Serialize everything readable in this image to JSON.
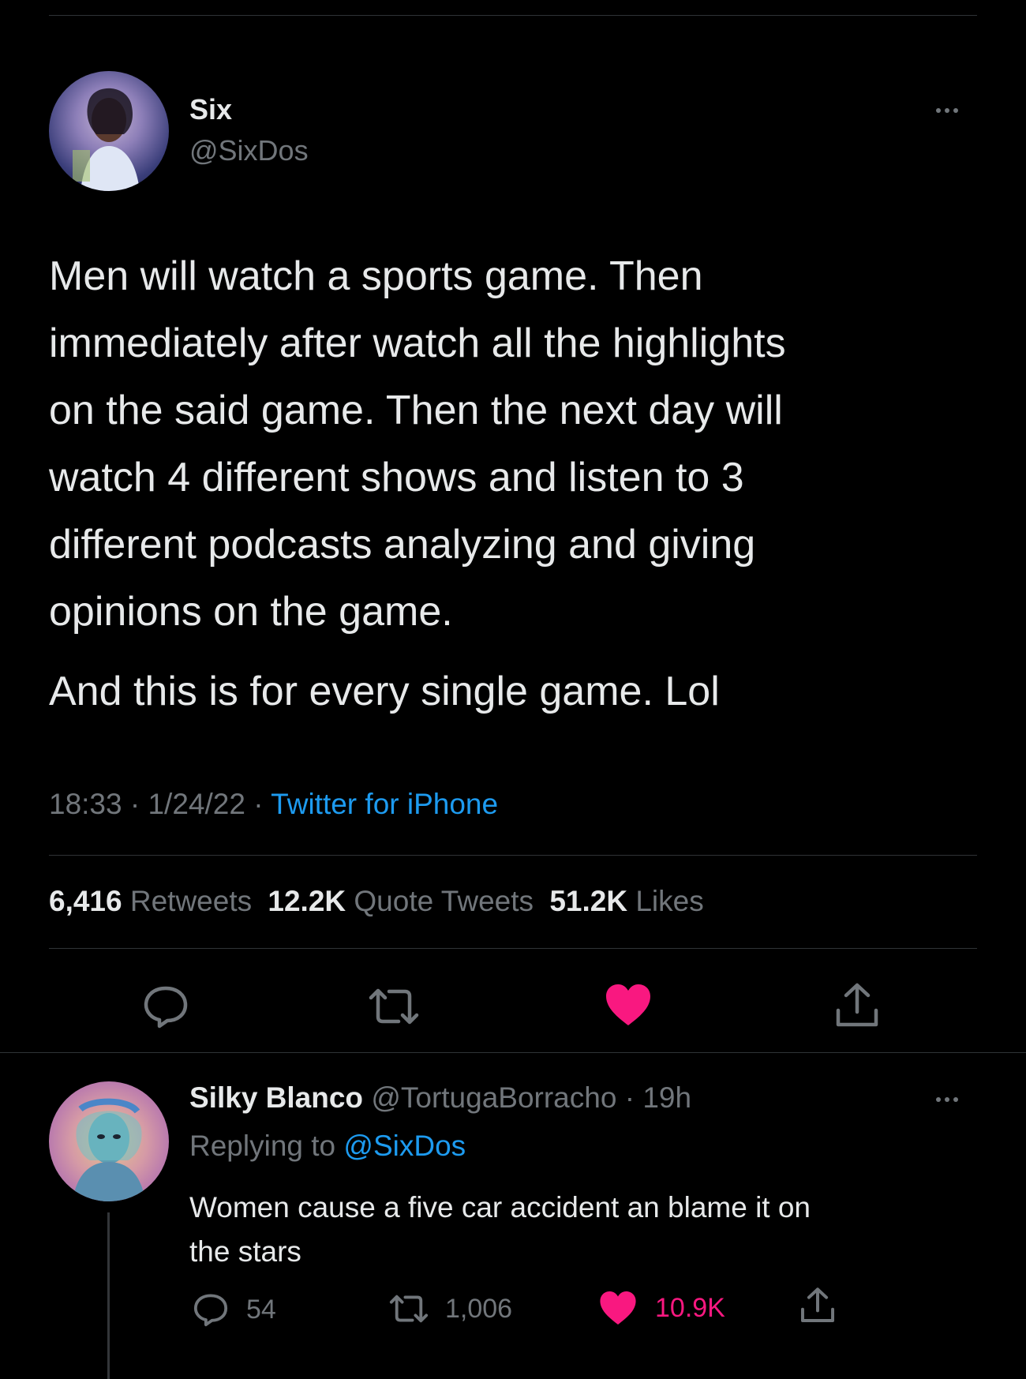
{
  "main_tweet": {
    "author_name": "Six",
    "author_handle": "@SixDos",
    "paragraph1_lines": [
      "Men will watch a sports game. Then",
      "immediately after watch all the highlights",
      "on the said game. Then the next day will",
      "watch 4 different shows and listen to 3",
      "different podcasts analyzing and giving",
      "opinions on the game."
    ],
    "paragraph2": "And this is for every single game. Lol",
    "time": "18:33",
    "sep": "·",
    "date": "1/24/22",
    "source": "Twitter for iPhone",
    "stats": {
      "retweets_count": "6,416",
      "retweets_label": "Retweets",
      "quotes_count": "12.2K",
      "quotes_label": "Quote Tweets",
      "likes_count": "51.2K",
      "likes_label": "Likes"
    },
    "liked": true
  },
  "reply": {
    "author_name": "Silky Blanco",
    "author_handle": "@TortugaBorracho",
    "sep": "·",
    "time": "19h",
    "replying_label": "Replying to",
    "replying_handle": "@SixDos",
    "text_lines": [
      "Women cause a five car accident an blame it on",
      "the stars"
    ],
    "reply_count": "54",
    "retweet_count": "1,006",
    "like_count": "10.9K",
    "liked": true
  },
  "colors": {
    "background": "#000000",
    "text": "#e7e9ea",
    "muted": "#71767b",
    "accent_blue": "#1d9bf0",
    "like_pink": "#f91880",
    "divider": "#2f3336"
  },
  "icons": [
    "reply-icon",
    "retweet-icon",
    "heart-icon",
    "share-icon",
    "more-icon"
  ]
}
